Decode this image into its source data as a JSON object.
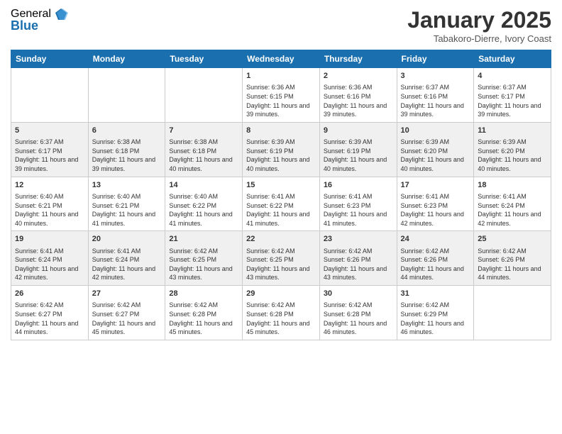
{
  "logo": {
    "general": "General",
    "blue": "Blue"
  },
  "header": {
    "month": "January 2025",
    "location": "Tabakoro-Dierre, Ivory Coast"
  },
  "days_of_week": [
    "Sunday",
    "Monday",
    "Tuesday",
    "Wednesday",
    "Thursday",
    "Friday",
    "Saturday"
  ],
  "weeks": [
    [
      {
        "day": "",
        "info": ""
      },
      {
        "day": "",
        "info": ""
      },
      {
        "day": "",
        "info": ""
      },
      {
        "day": "1",
        "info": "Sunrise: 6:36 AM\nSunset: 6:15 PM\nDaylight: 11 hours and 39 minutes."
      },
      {
        "day": "2",
        "info": "Sunrise: 6:36 AM\nSunset: 6:16 PM\nDaylight: 11 hours and 39 minutes."
      },
      {
        "day": "3",
        "info": "Sunrise: 6:37 AM\nSunset: 6:16 PM\nDaylight: 11 hours and 39 minutes."
      },
      {
        "day": "4",
        "info": "Sunrise: 6:37 AM\nSunset: 6:17 PM\nDaylight: 11 hours and 39 minutes."
      }
    ],
    [
      {
        "day": "5",
        "info": "Sunrise: 6:37 AM\nSunset: 6:17 PM\nDaylight: 11 hours and 39 minutes."
      },
      {
        "day": "6",
        "info": "Sunrise: 6:38 AM\nSunset: 6:18 PM\nDaylight: 11 hours and 39 minutes."
      },
      {
        "day": "7",
        "info": "Sunrise: 6:38 AM\nSunset: 6:18 PM\nDaylight: 11 hours and 40 minutes."
      },
      {
        "day": "8",
        "info": "Sunrise: 6:39 AM\nSunset: 6:19 PM\nDaylight: 11 hours and 40 minutes."
      },
      {
        "day": "9",
        "info": "Sunrise: 6:39 AM\nSunset: 6:19 PM\nDaylight: 11 hours and 40 minutes."
      },
      {
        "day": "10",
        "info": "Sunrise: 6:39 AM\nSunset: 6:20 PM\nDaylight: 11 hours and 40 minutes."
      },
      {
        "day": "11",
        "info": "Sunrise: 6:39 AM\nSunset: 6:20 PM\nDaylight: 11 hours and 40 minutes."
      }
    ],
    [
      {
        "day": "12",
        "info": "Sunrise: 6:40 AM\nSunset: 6:21 PM\nDaylight: 11 hours and 40 minutes."
      },
      {
        "day": "13",
        "info": "Sunrise: 6:40 AM\nSunset: 6:21 PM\nDaylight: 11 hours and 41 minutes."
      },
      {
        "day": "14",
        "info": "Sunrise: 6:40 AM\nSunset: 6:22 PM\nDaylight: 11 hours and 41 minutes."
      },
      {
        "day": "15",
        "info": "Sunrise: 6:41 AM\nSunset: 6:22 PM\nDaylight: 11 hours and 41 minutes."
      },
      {
        "day": "16",
        "info": "Sunrise: 6:41 AM\nSunset: 6:23 PM\nDaylight: 11 hours and 41 minutes."
      },
      {
        "day": "17",
        "info": "Sunrise: 6:41 AM\nSunset: 6:23 PM\nDaylight: 11 hours and 42 minutes."
      },
      {
        "day": "18",
        "info": "Sunrise: 6:41 AM\nSunset: 6:24 PM\nDaylight: 11 hours and 42 minutes."
      }
    ],
    [
      {
        "day": "19",
        "info": "Sunrise: 6:41 AM\nSunset: 6:24 PM\nDaylight: 11 hours and 42 minutes."
      },
      {
        "day": "20",
        "info": "Sunrise: 6:41 AM\nSunset: 6:24 PM\nDaylight: 11 hours and 42 minutes."
      },
      {
        "day": "21",
        "info": "Sunrise: 6:42 AM\nSunset: 6:25 PM\nDaylight: 11 hours and 43 minutes."
      },
      {
        "day": "22",
        "info": "Sunrise: 6:42 AM\nSunset: 6:25 PM\nDaylight: 11 hours and 43 minutes."
      },
      {
        "day": "23",
        "info": "Sunrise: 6:42 AM\nSunset: 6:26 PM\nDaylight: 11 hours and 43 minutes."
      },
      {
        "day": "24",
        "info": "Sunrise: 6:42 AM\nSunset: 6:26 PM\nDaylight: 11 hours and 44 minutes."
      },
      {
        "day": "25",
        "info": "Sunrise: 6:42 AM\nSunset: 6:26 PM\nDaylight: 11 hours and 44 minutes."
      }
    ],
    [
      {
        "day": "26",
        "info": "Sunrise: 6:42 AM\nSunset: 6:27 PM\nDaylight: 11 hours and 44 minutes."
      },
      {
        "day": "27",
        "info": "Sunrise: 6:42 AM\nSunset: 6:27 PM\nDaylight: 11 hours and 45 minutes."
      },
      {
        "day": "28",
        "info": "Sunrise: 6:42 AM\nSunset: 6:28 PM\nDaylight: 11 hours and 45 minutes."
      },
      {
        "day": "29",
        "info": "Sunrise: 6:42 AM\nSunset: 6:28 PM\nDaylight: 11 hours and 45 minutes."
      },
      {
        "day": "30",
        "info": "Sunrise: 6:42 AM\nSunset: 6:28 PM\nDaylight: 11 hours and 46 minutes."
      },
      {
        "day": "31",
        "info": "Sunrise: 6:42 AM\nSunset: 6:29 PM\nDaylight: 11 hours and 46 minutes."
      },
      {
        "day": "",
        "info": ""
      }
    ]
  ]
}
